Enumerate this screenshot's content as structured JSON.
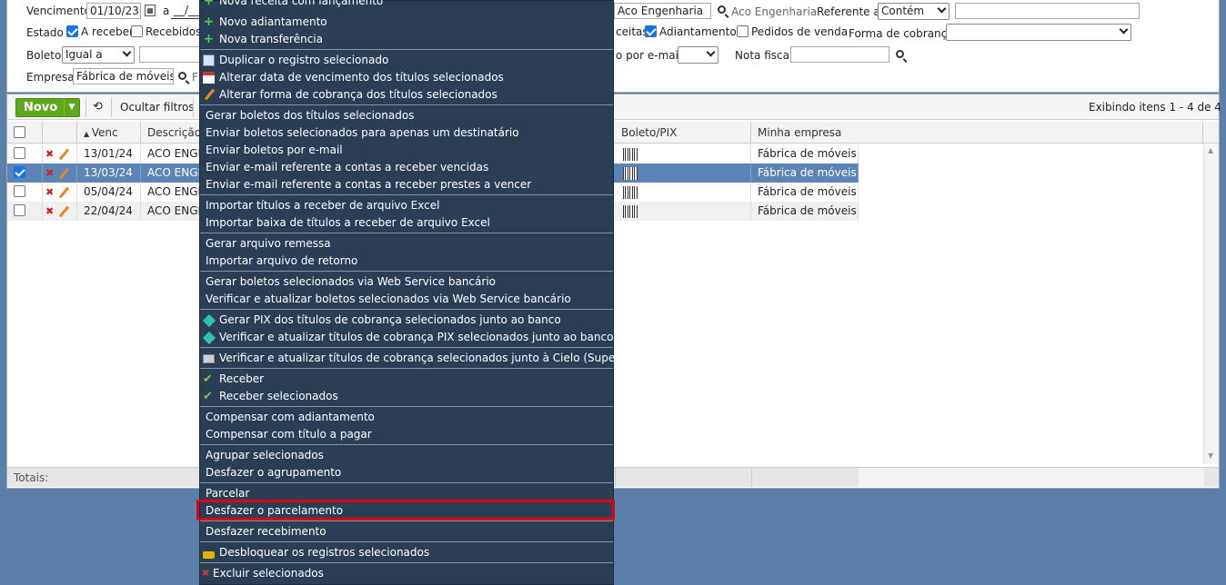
{
  "filters": {
    "vencimento_label": "Vencimento",
    "vencimento_from": "01/10/23",
    "a_label": "a",
    "vencimento_to": "__/__",
    "cliente_value": "Aco Engenharia",
    "cliente_display": "Aco Engenharia",
    "referente_label": "Referente a",
    "referente_select": "Contém",
    "estado_label": "Estado",
    "estado_options": [
      {
        "label": "A receber",
        "checked": true
      },
      {
        "label": "Recebidos",
        "checked": false
      }
    ],
    "tipo_options": [
      {
        "label": "ceitas",
        "checked": false
      },
      {
        "label": "Adiantamentos",
        "checked": true
      },
      {
        "label": "Pedidos de venda",
        "checked": false
      }
    ],
    "forma_cobranca_label": "Forma de cobrança",
    "boleto_label": "Boleto",
    "boleto_select": "Igual a",
    "email_label": "o por e-mail",
    "nota_fiscal_label": "Nota fiscal",
    "empresa_label": "Empresa",
    "empresa_value": "Fábrica de móveis -",
    "empresa_extra": "F"
  },
  "toolbar": {
    "novo_label": "Novo",
    "ocultar_label": "Ocultar filtros",
    "exibindo": "Exibindo itens 1 - 4 de 4"
  },
  "columns": {
    "venc": "Venc",
    "descricao": "Descrição",
    "boleto": "Boleto/PIX",
    "empresa": "Minha empresa"
  },
  "rows": [
    {
      "venc": "13/01/24",
      "desc": "ACO ENGEN",
      "empresa": "Fábrica de móveis...",
      "selected": false
    },
    {
      "venc": "13/03/24",
      "desc": "ACO ENGEN",
      "empresa": "Fábrica de móveis...",
      "selected": true
    },
    {
      "venc": "05/04/24",
      "desc": "ACO ENGEN",
      "empresa": "Fábrica de móveis...",
      "selected": false
    },
    {
      "venc": "22/04/24",
      "desc": "ACO ENGEN",
      "empresa": "Fábrica de móveis...",
      "selected": false
    }
  ],
  "footer": {
    "totais": "Totais:"
  },
  "menu": {
    "items": [
      {
        "label": "Nova receita com lançamento",
        "icon": "plus-icon"
      },
      {
        "label": "Novo adiantamento",
        "icon": "plus-icon"
      },
      {
        "label": "Nova transferência",
        "icon": "plus-icon"
      },
      {
        "label": "Duplicar o registro selecionado",
        "icon": "duplicate-icon"
      },
      {
        "label": "Alterar data de vencimento dos títulos selecionados",
        "icon": "calendar-icon"
      },
      {
        "label": "Alterar forma de cobrança dos títulos selecionados",
        "icon": "pencil-icon"
      },
      {
        "label": "Gerar boletos dos títulos selecionados",
        "icon": ""
      },
      {
        "label": "Enviar boletos selecionados para apenas um destinatário",
        "icon": ""
      },
      {
        "label": "Enviar boletos por e-mail",
        "icon": ""
      },
      {
        "label": "Enviar e-mail referente a contas a receber vencidas",
        "icon": ""
      },
      {
        "label": "Enviar e-mail referente a contas a receber prestes a vencer",
        "icon": ""
      },
      {
        "label": "Importar títulos a receber de arquivo Excel",
        "icon": ""
      },
      {
        "label": "Importar baixa de títulos a receber de arquivo Excel",
        "icon": ""
      },
      {
        "label": "Gerar arquivo remessa",
        "icon": ""
      },
      {
        "label": "Importar arquivo de retorno",
        "icon": ""
      },
      {
        "label": "Gerar boletos selecionados via Web Service bancário",
        "icon": ""
      },
      {
        "label": "Verificar e atualizar boletos selecionados via Web Service bancário",
        "icon": ""
      },
      {
        "label": "Gerar PIX dos títulos de cobrança selecionados junto ao banco",
        "icon": "pix-icon"
      },
      {
        "label": "Verificar e atualizar títulos de cobrança PIX selecionados junto ao banco",
        "icon": "pix-icon"
      },
      {
        "label": "Verificar e atualizar títulos de cobrança selecionados junto à Cielo (Super Link)",
        "icon": "card-icon"
      },
      {
        "label": "Receber",
        "icon": "check-icon"
      },
      {
        "label": "Receber selecionados",
        "icon": "check-icon"
      },
      {
        "label": "Compensar com adiantamento",
        "icon": ""
      },
      {
        "label": "Compensar com título a pagar",
        "icon": ""
      },
      {
        "label": "Agrupar selecionados",
        "icon": ""
      },
      {
        "label": "Desfazer o agrupamento",
        "icon": ""
      },
      {
        "label": "Parcelar",
        "icon": ""
      },
      {
        "label": "Desfazer o parcelamento",
        "icon": ""
      },
      {
        "label": "Desfazer recebimento",
        "icon": ""
      },
      {
        "label": "Desbloquear os registros selecionados",
        "icon": "unlock-icon"
      },
      {
        "label": "Excluir selecionados",
        "icon": "delete-icon"
      }
    ]
  }
}
